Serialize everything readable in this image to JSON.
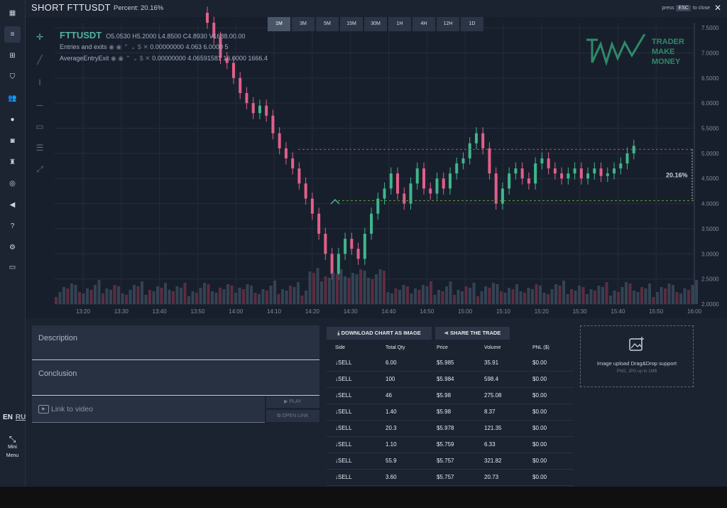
{
  "header": {
    "title": "SHORT FTTUSDT",
    "percent": "Percent: 20.16%",
    "esc_press": "press",
    "esc_key": "ESC",
    "esc_after": "to close"
  },
  "timeframes": [
    "1M",
    "3M",
    "5M",
    "15M",
    "30M",
    "1H",
    "4H",
    "12H",
    "1D"
  ],
  "legend": {
    "symbol": "FTTUSDT",
    "ohlc": "O5.0530 H5.2000 L4.8500 C4.8930 V1688.00.00",
    "row1_label": "Entries and exits",
    "row1_values": "0.00000000  4.063  6.0000  5",
    "row2_label": "AverageEntryExit",
    "row2_values": "0.00000000  4.06591581  16.0000  1666.4"
  },
  "logo": {
    "line1": "TRADER",
    "line2": "MAKE",
    "line3": "MONEY"
  },
  "chart": {
    "price_labels": [
      "7.5000",
      "7.0000",
      "6.5000",
      "6.0000",
      "5.5000",
      "5.0000",
      "4.5000",
      "4.0000",
      "3.5000",
      "3.0000",
      "2.5000",
      "2.0000"
    ],
    "time_labels": [
      "13:20",
      "13:30",
      "13:40",
      "13:50",
      "14:00",
      "14:10",
      "14:20",
      "14:30",
      "14:40",
      "14:50",
      "15:00",
      "15:10",
      "15:20",
      "15:30",
      "15:40",
      "15:50",
      "16:00"
    ],
    "pct_label": "20.16%",
    "entry_price": 5.08,
    "exit_price": 4.06,
    "up_color": "#3fb68b",
    "down_color": "#e0608a"
  },
  "chart_data": {
    "type": "candlestick",
    "ylim": [
      2.0,
      7.6
    ],
    "x_ticks": [
      "13:20",
      "13:30",
      "13:40",
      "13:50",
      "14:00",
      "14:10",
      "14:20",
      "14:30",
      "14:40",
      "14:50",
      "15:00",
      "15:10",
      "15:20",
      "15:30",
      "15:40",
      "15:50",
      "16:00"
    ],
    "closes": [
      7.6,
      7.3,
      6.9,
      6.8,
      6.5,
      6.2,
      6.0,
      5.8,
      5.95,
      5.75,
      5.4,
      5.1,
      4.9,
      4.7,
      4.4,
      4.1,
      3.8,
      3.4,
      3.0,
      2.6,
      3.0,
      3.3,
      3.1,
      2.9,
      3.4,
      3.8,
      4.1,
      4.3,
      4.6,
      4.2,
      4.0,
      4.4,
      4.7,
      4.3,
      4.2,
      4.5,
      4.3,
      4.6,
      4.8,
      4.9,
      5.2,
      5.4,
      5.1,
      4.6,
      4.0,
      4.3,
      4.6,
      4.7,
      4.5,
      4.4,
      4.8,
      4.9,
      4.7,
      4.6,
      4.5,
      4.6,
      4.7,
      4.5,
      4.6,
      4.7,
      4.55,
      4.6,
      4.7,
      4.8,
      5.0,
      5.15
    ]
  },
  "panel": {
    "description": "Description",
    "conclusion": "Conclusion",
    "video": "Link to video",
    "play": "PLAY",
    "open_link": "OPEN LINK"
  },
  "actions": {
    "download": "DOWNLOAD CHART AS IMAGE",
    "share": "SHARE THE TRADE"
  },
  "table": {
    "headers": [
      "Side",
      "Total Qty",
      "Price",
      "Volume",
      "PNL ($)"
    ],
    "rows": [
      [
        "SELL",
        "6.00",
        "$5.985",
        "35.91",
        "$0.00"
      ],
      [
        "SELL",
        "100",
        "$5.984",
        "598.4",
        "$0.00"
      ],
      [
        "SELL",
        "46",
        "$5.98",
        "275.08",
        "$0.00"
      ],
      [
        "SELL",
        "1.40",
        "$5.98",
        "8.37",
        "$0.00"
      ],
      [
        "SELL",
        "20.3",
        "$5.978",
        "121.35",
        "$0.00"
      ],
      [
        "SELL",
        "1.10",
        "$5.759",
        "6.33",
        "$0.00"
      ],
      [
        "SELL",
        "55.9",
        "$5.757",
        "321.82",
        "$0.00"
      ],
      [
        "SELL",
        "3.60",
        "$5.757",
        "20.73",
        "$0.00"
      ]
    ]
  },
  "upload": {
    "text": "Image upload Drag&Drop support",
    "sub": "PNG, JPG up to 1MB"
  },
  "sidebar": {
    "lang_en": "EN",
    "lang_ru": "RU",
    "mini": "Mini",
    "menu": "Menu"
  }
}
